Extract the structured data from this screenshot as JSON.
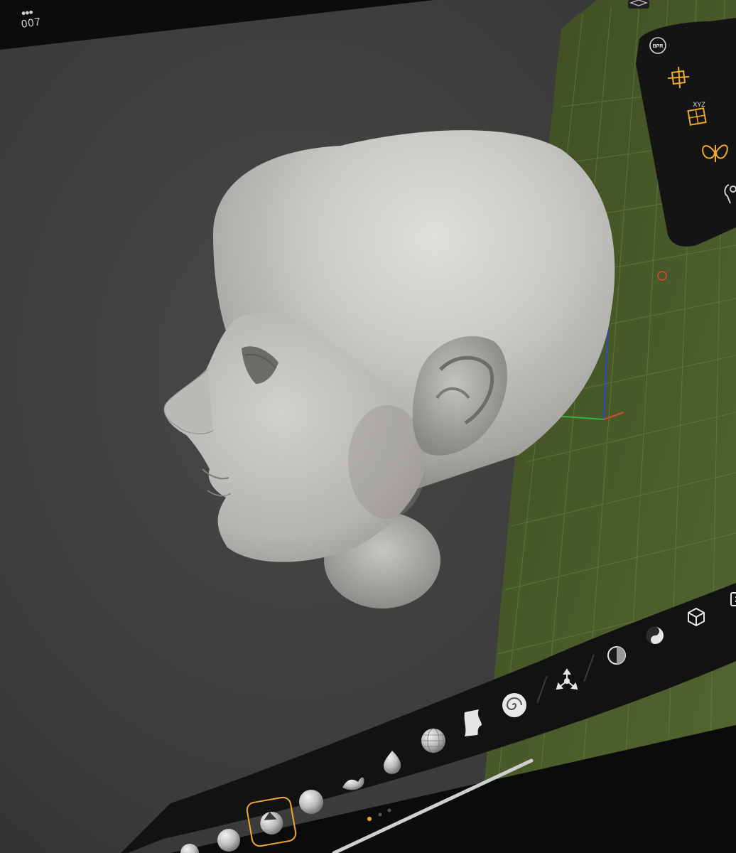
{
  "top_bar": {
    "menu_dots": "•••",
    "counter": "007"
  },
  "right_rail": {
    "items": [
      {
        "name": "layers",
        "icon": "layers-icon",
        "active": false
      },
      {
        "name": "bpr-render",
        "label": "BPR",
        "icon": "bpr-icon",
        "active": false
      },
      {
        "name": "gizmo",
        "icon": "gizmo-icon",
        "active": true
      },
      {
        "name": "symmetry-xyz",
        "label": "XYZ",
        "icon": "grid-symmetry-icon",
        "active": true
      },
      {
        "name": "symmetry",
        "icon": "butterfly-icon",
        "active": true
      },
      {
        "name": "mirror",
        "icon": "figure-icon",
        "active": false
      }
    ]
  },
  "bottom_toolbar": {
    "brushes": [
      {
        "name": "standard-brush",
        "icon": "sphere-icon"
      },
      {
        "name": "clay-brush",
        "icon": "sphere-icon"
      },
      {
        "name": "move-brush",
        "icon": "cone-sphere-icon",
        "selected": true
      },
      {
        "name": "smooth-brush",
        "icon": "sphere-icon"
      },
      {
        "name": "curve-brush",
        "icon": "creature-icon"
      },
      {
        "name": "inflate-brush",
        "icon": "drop-icon"
      },
      {
        "name": "mesh-brush",
        "icon": "wire-sphere-icon"
      },
      {
        "name": "trim-brush",
        "icon": "cut-block-icon"
      },
      {
        "name": "twist-brush",
        "icon": "swirl-icon"
      }
    ],
    "actions": [
      {
        "name": "transform",
        "icon": "transform-icon"
      },
      {
        "name": "material",
        "icon": "matcap-icon"
      },
      {
        "name": "color",
        "icon": "yin-yang-icon"
      },
      {
        "name": "primitive",
        "icon": "cube-icon"
      },
      {
        "name": "more",
        "icon": "panel-icon"
      }
    ],
    "page_indicator": {
      "pages": 3,
      "active": 0
    }
  },
  "colors": {
    "accent": "#f0a830",
    "viewport_bg": "#3e3e3e",
    "grid_floor": "#4a5a2a",
    "toolbar_bg": "#141414",
    "model": "#c8c6c2"
  }
}
